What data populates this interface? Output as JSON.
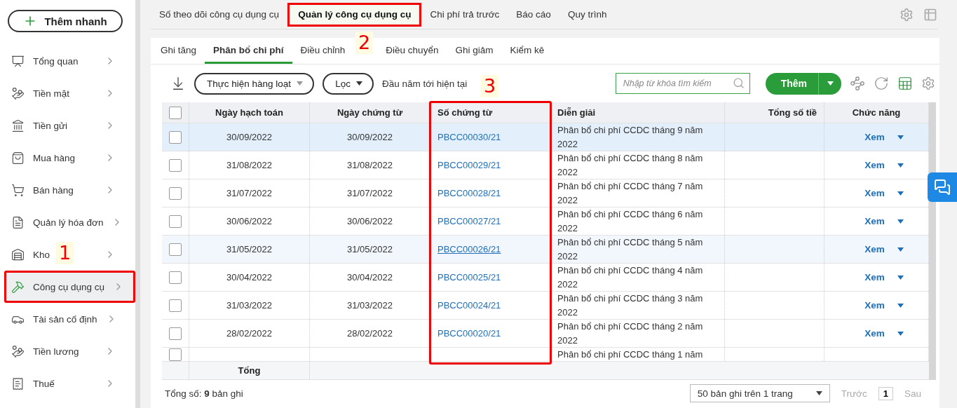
{
  "quick_add": {
    "label": "Thêm nhanh"
  },
  "sidebar": {
    "items": [
      {
        "label": "Tổng quan",
        "selected": false
      },
      {
        "label": "Tiền mặt",
        "selected": false
      },
      {
        "label": "Tiền gửi",
        "selected": false
      },
      {
        "label": "Mua hàng",
        "selected": false
      },
      {
        "label": "Bán hàng",
        "selected": false
      },
      {
        "label": "Quản lý hóa đơn",
        "selected": false
      },
      {
        "label": "Kho",
        "selected": false
      },
      {
        "label": "Công cụ dụng cụ",
        "selected": true,
        "marker": "1"
      },
      {
        "label": "Tài sản cố định",
        "selected": false
      },
      {
        "label": "Tiền lương",
        "selected": false
      },
      {
        "label": "Thuế",
        "selected": false
      }
    ]
  },
  "top_tabs": [
    {
      "label": "Số theo dõi công cụ dụng cụ",
      "selected": false
    },
    {
      "label": "Quản lý công cụ dụng cụ",
      "selected": true,
      "marker": "2"
    },
    {
      "label": "Chi phí trả trước",
      "selected": false
    },
    {
      "label": "Báo cáo",
      "selected": false
    },
    {
      "label": "Quy trình",
      "selected": false
    }
  ],
  "sub_tabs": [
    {
      "label": "Ghi tăng",
      "selected": false
    },
    {
      "label": "Phân bổ chi phí",
      "selected": true
    },
    {
      "label": "Điều chỉnh",
      "selected": false
    },
    {
      "label": "Điều chuyển",
      "selected": false
    },
    {
      "label": "Ghi giảm",
      "selected": false
    },
    {
      "label": "Kiểm kê",
      "selected": false
    }
  ],
  "toolbar": {
    "bulk_action": "Thực hiện hàng loạt",
    "filter": "Lọc",
    "period": "Đầu năm tới hiện tại",
    "search": {
      "placeholder": "Nhập từ khóa tìm kiếm"
    },
    "add": "Thêm"
  },
  "table": {
    "select_all_checked": false,
    "columns": [
      {
        "label": "Ngày hạch toán"
      },
      {
        "label": "Ngày chứng từ"
      },
      {
        "label": "Số chứng từ",
        "marker": "3"
      },
      {
        "label": "Diễn giải"
      },
      {
        "label": "Tổng số tiề"
      },
      {
        "label": "Chức năng"
      }
    ],
    "rows": [
      {
        "checked": false,
        "selected": true,
        "hovered": false,
        "posting_date": "30/09/2022",
        "doc_date": "30/09/2022",
        "doc_no": "PBCC00030/21",
        "description": "Phân bổ chi phí CCDC tháng 9 năm 2022",
        "action": "Xem"
      },
      {
        "checked": false,
        "selected": false,
        "hovered": false,
        "posting_date": "31/08/2022",
        "doc_date": "31/08/2022",
        "doc_no": "PBCC00029/21",
        "description": "Phân bổ chi phí CCDC tháng 8 năm 2022",
        "action": "Xem"
      },
      {
        "checked": false,
        "selected": false,
        "hovered": false,
        "posting_date": "31/07/2022",
        "doc_date": "31/07/2022",
        "doc_no": "PBCC00028/21",
        "description": "Phân bổ chi phí CCDC tháng 7 năm 2022",
        "action": "Xem"
      },
      {
        "checked": false,
        "selected": false,
        "hovered": false,
        "posting_date": "30/06/2022",
        "doc_date": "30/06/2022",
        "doc_no": "PBCC00027/21",
        "description": "Phân bổ chi phí CCDC tháng 6 năm 2022",
        "action": "Xem"
      },
      {
        "checked": false,
        "selected": false,
        "hovered": true,
        "posting_date": "31/05/2022",
        "doc_date": "31/05/2022",
        "doc_no": "PBCC00026/21",
        "description": "Phân bổ chi phí CCDC tháng 5 năm 2022",
        "action": "Xem"
      },
      {
        "checked": false,
        "selected": false,
        "hovered": false,
        "posting_date": "30/04/2022",
        "doc_date": "30/04/2022",
        "doc_no": "PBCC00025/21",
        "description": "Phân bổ chi phí CCDC tháng 4 năm 2022",
        "action": "Xem"
      },
      {
        "checked": false,
        "selected": false,
        "hovered": false,
        "posting_date": "31/03/2022",
        "doc_date": "31/03/2022",
        "doc_no": "PBCC00024/21",
        "description": "Phân bổ chi phí CCDC tháng 3 năm 2022",
        "action": "Xem"
      },
      {
        "checked": false,
        "selected": false,
        "hovered": false,
        "posting_date": "28/02/2022",
        "doc_date": "28/02/2022",
        "doc_no": "PBCC00020/21",
        "description": "Phân bổ chi phí CCDC tháng 2 năm 2022",
        "action": "Xem"
      },
      {
        "checked": false,
        "selected": false,
        "hovered": false,
        "description": "Phân bổ chi phí CCDC tháng 1 năm"
      }
    ],
    "total_label": "Tổng"
  },
  "footer": {
    "record_count": "Tổng số: **9** bản ghi",
    "page_size": "50 bản ghi trên 1 trang",
    "prev": "Trước",
    "page": "1",
    "next": "Sau"
  }
}
